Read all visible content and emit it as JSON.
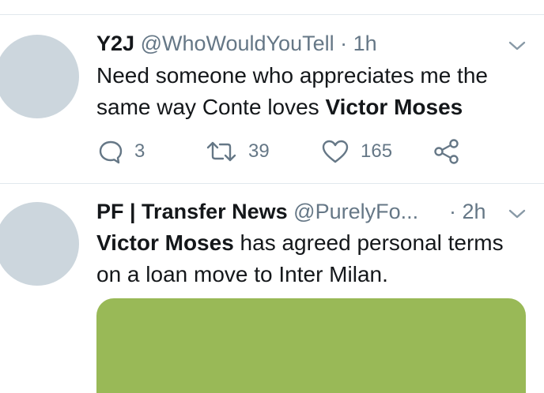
{
  "tweets": [
    {
      "name": "Y2J",
      "handle": "@WhoWouldYouTell",
      "separator": "·",
      "time": "1h",
      "text_line1": "Need someone who appreciates me the",
      "text_line2_plain": "same way Conte loves ",
      "text_line2_bold": "Victor Moses",
      "replies": "3",
      "retweets": "39",
      "likes": "165",
      "icons": [
        "reply-icon",
        "retweet-icon",
        "like-icon",
        "share-icon",
        "chevron-down-icon"
      ]
    },
    {
      "name": "PF | Transfer News",
      "handle": "@PurelyFo...",
      "separator": "·",
      "time": "2h",
      "text_line1_bold": "Victor Moses",
      "text_line1_plain": " has agreed personal terms",
      "text_line2": "on a loan move to Inter Milan.",
      "media_color": "#99b957"
    }
  ],
  "colors": {
    "text": "#14171a",
    "secondary": "#657786",
    "avatar": "#ccd6dd",
    "divider": "#e1e8ed"
  }
}
